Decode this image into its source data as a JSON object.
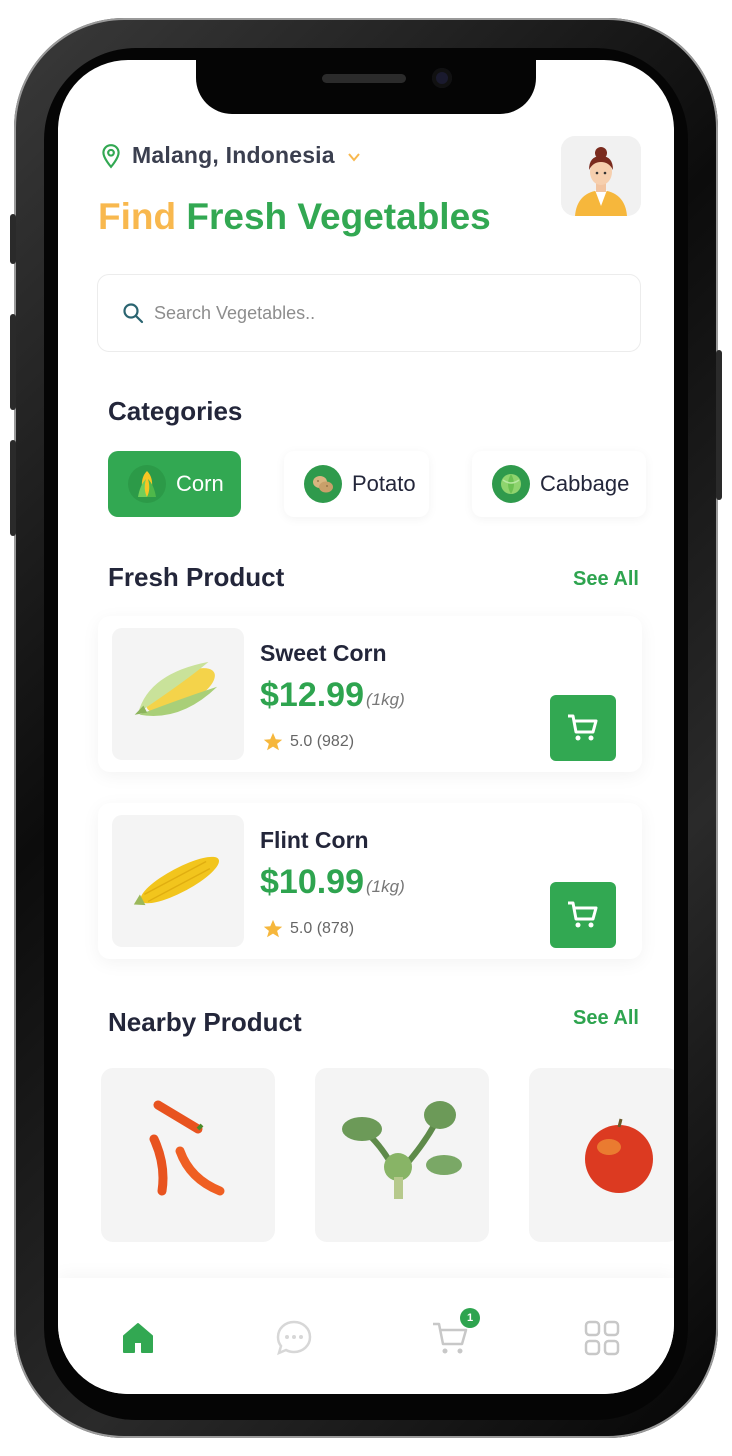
{
  "header": {
    "location": "Malang, Indonesia",
    "headline_part1": "Find",
    "headline_part2": "Fresh Vegetables"
  },
  "search": {
    "placeholder": "Search Vegetables.."
  },
  "categories": {
    "title": "Categories",
    "items": [
      {
        "label": "Corn",
        "icon": "corn-icon",
        "active": true
      },
      {
        "label": "Potato",
        "icon": "potato-icon",
        "active": false
      },
      {
        "label": "Cabbage",
        "icon": "cabbage-icon",
        "active": false
      }
    ]
  },
  "fresh": {
    "title": "Fresh Product",
    "see_all": "See All",
    "items": [
      {
        "name": "Sweet Corn",
        "price": "$12.99",
        "unit": "(1kg)",
        "rating": "5.0 (982)"
      },
      {
        "name": "Flint Corn",
        "price": "$10.99",
        "unit": "(1kg)",
        "rating": "5.0 (878)"
      }
    ]
  },
  "nearby": {
    "title": "Nearby Product",
    "see_all": "See All",
    "items": [
      "chili-image",
      "broccoli-image",
      "tomato-image"
    ]
  },
  "tabbar": {
    "cart_badge": "1"
  },
  "colors": {
    "accent": "#32a852",
    "headline_orange": "#f8b84e",
    "text_dark": "#23263a"
  }
}
